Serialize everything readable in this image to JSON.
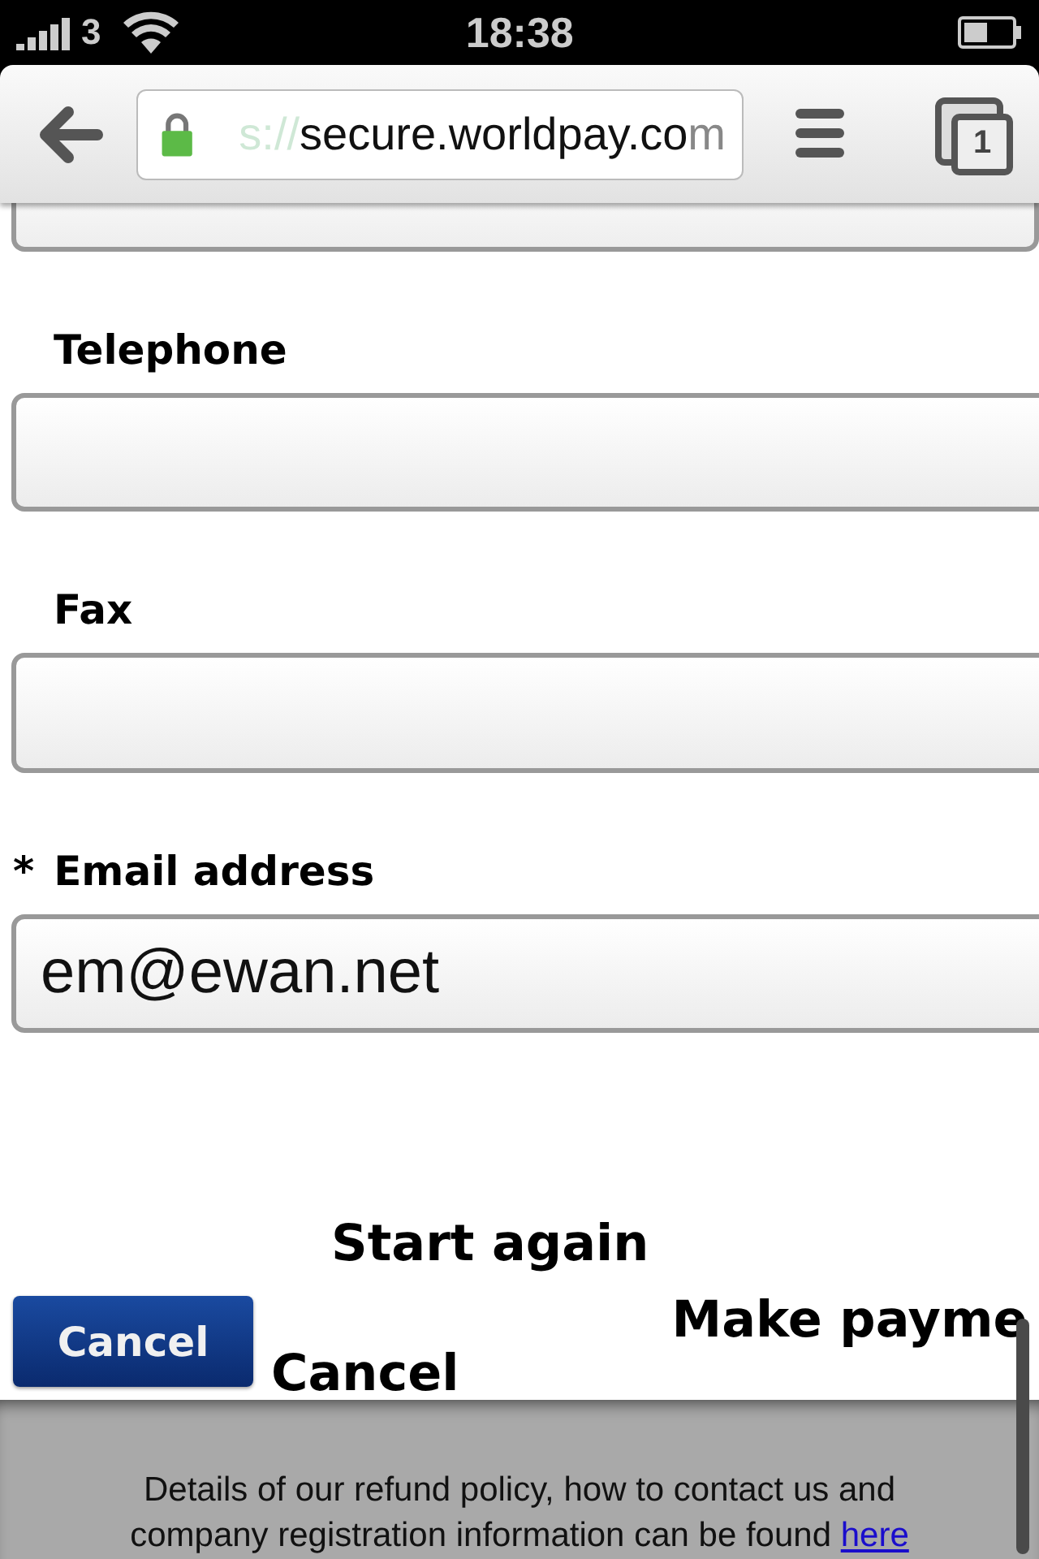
{
  "status_bar": {
    "carrier": "3",
    "time": "18:38"
  },
  "toolbar": {
    "url_faded": "s://",
    "url": "secure.worldpay.co",
    "url_tail": "m",
    "tab_count": "1"
  },
  "form": {
    "fields": [
      {
        "label": "Telephone",
        "required": false
      },
      {
        "label": "Fax",
        "required": false
      },
      {
        "label": "Email address",
        "required": true,
        "required_mark": "*",
        "value": "em@ewan.net"
      }
    ]
  },
  "actions": {
    "start_again": "Start again",
    "cancel_image_button": "Cancel",
    "cancel": "Cancel",
    "make_payment": "Make payme"
  },
  "footer": {
    "text": "Details of our refund policy, how to contact us and company registration information can be found",
    "link": "here"
  }
}
